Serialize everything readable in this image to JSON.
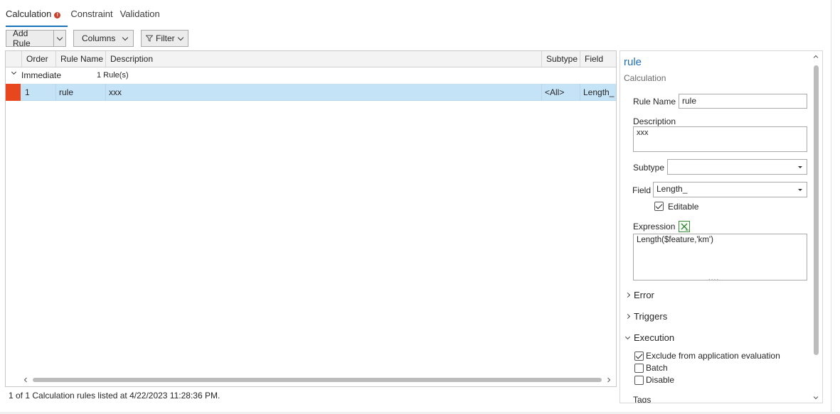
{
  "tabs": [
    {
      "label": "Calculation",
      "active": true,
      "warning": true
    },
    {
      "label": "Constraint"
    },
    {
      "label": "Validation"
    }
  ],
  "toolbar": {
    "add_rule": "Add Rule",
    "columns": "Columns",
    "filter": "Filter"
  },
  "grid": {
    "columns": [
      "Order",
      "Rule Name",
      "Description",
      "Subtype",
      "Field"
    ],
    "group": {
      "name": "Immediate",
      "count": "1 Rule(s)"
    },
    "rows": [
      {
        "order": "1",
        "rule_name": "rule",
        "description": "xxx",
        "subtype": "<All>",
        "field": "Length_"
      }
    ]
  },
  "status": "1 of 1 Calculation rules listed at 4/22/2023 11:28:36 PM.",
  "panel": {
    "title": "rule",
    "subtitle": "Calculation",
    "rule_name_label": "Rule Name",
    "rule_name_value": "rule",
    "description_label": "Description",
    "description_value": "xxx",
    "subtype_label": "Subtype",
    "subtype_value": "",
    "field_label": "Field",
    "field_value": "Length_",
    "editable_label": "Editable",
    "editable_checked": true,
    "expression_label": "Expression",
    "expression_value": "Length($feature,'km')",
    "expression_resize": "....",
    "sections": {
      "error": "Error",
      "triggers": "Triggers",
      "execution": "Execution",
      "tags": "Tags"
    },
    "execution": {
      "exclude_label": "Exclude from application evaluation",
      "exclude_checked": true,
      "batch_label": "Batch",
      "batch_checked": false,
      "disable_label": "Disable",
      "disable_checked": false
    }
  },
  "colors": {
    "accent": "#1a73b8",
    "selection": "#c5e3f7",
    "row_marker": "#e8461d",
    "title": "#1f6fb5"
  }
}
